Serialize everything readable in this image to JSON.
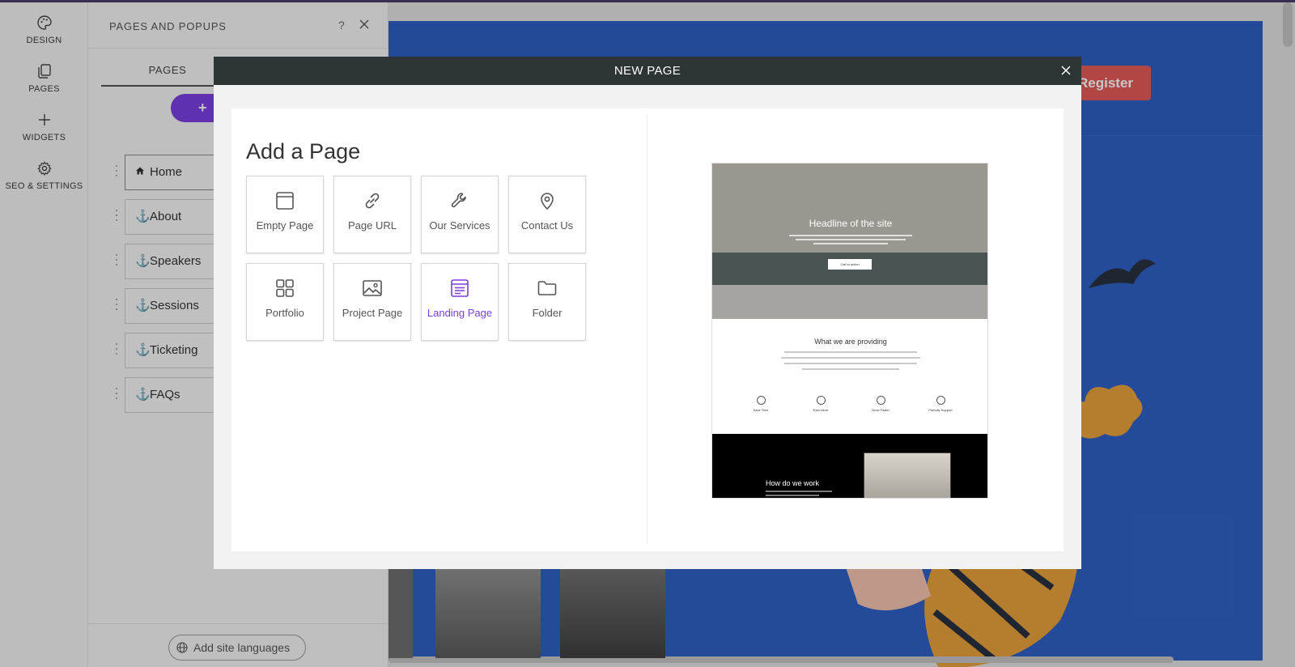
{
  "rail": {
    "items": [
      {
        "label": "DESIGN",
        "icon": "palette-icon"
      },
      {
        "label": "PAGES",
        "icon": "pages-icon"
      },
      {
        "label": "WIDGETS",
        "icon": "plus-icon"
      },
      {
        "label": "SEO & SETTINGS",
        "icon": "gear-icon"
      }
    ]
  },
  "panel": {
    "title": "PAGES AND POPUPS",
    "help": "?",
    "tab": "PAGES",
    "add_label": "+",
    "pages": [
      {
        "label": "Home",
        "icon": "home-icon"
      },
      {
        "label": "About",
        "icon": "anchor-icon"
      },
      {
        "label": "Speakers",
        "icon": "anchor-icon"
      },
      {
        "label": "Sessions",
        "icon": "anchor-icon"
      },
      {
        "label": "Ticketing",
        "icon": "anchor-icon"
      },
      {
        "label": "FAQs",
        "icon": "anchor-icon"
      }
    ],
    "lang_label": "Add site languages"
  },
  "site": {
    "register_label": "Register"
  },
  "modal": {
    "title": "NEW PAGE",
    "heading": "Add a Page",
    "tiles": [
      {
        "label": "Empty Page",
        "icon": "empty-page-icon"
      },
      {
        "label": "Page URL",
        "icon": "link-icon"
      },
      {
        "label": "Our Services",
        "icon": "wrench-icon"
      },
      {
        "label": "Contact Us",
        "icon": "map-pin-icon"
      },
      {
        "label": "Portfolio",
        "icon": "grid-icon"
      },
      {
        "label": "Project Page",
        "icon": "image-icon"
      },
      {
        "label": "Landing Page",
        "icon": "landing-page-icon",
        "selected": true
      },
      {
        "label": "Folder",
        "icon": "folder-icon"
      }
    ],
    "preview": {
      "headline": "Headline of the site",
      "cta": "Call to action",
      "section_title": "What we are providing",
      "features": [
        "Save Time",
        "Earn More",
        "Grow Faster",
        "Friendly Support"
      ],
      "dark_title": "How do we work"
    }
  },
  "colors": {
    "accent": "#7a3ee0",
    "header_dark": "#2d3436",
    "site_blue": "#2f61c6",
    "register": "#e25b59"
  }
}
